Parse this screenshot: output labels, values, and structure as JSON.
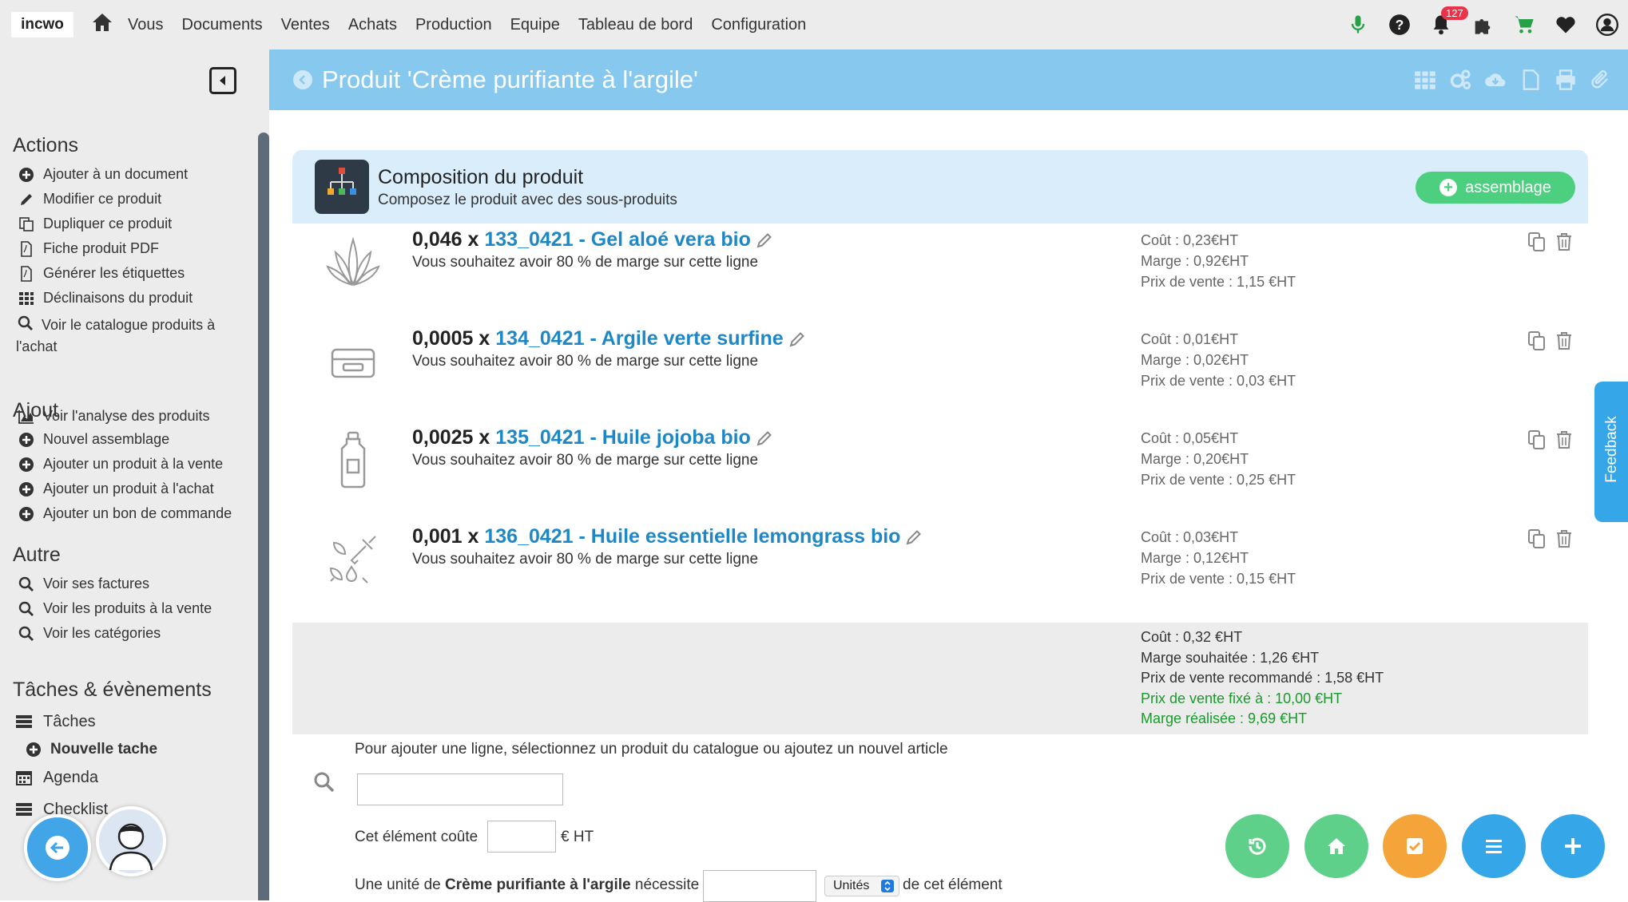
{
  "topbar": {
    "logo": "incwo",
    "menu": [
      "Vous",
      "Documents",
      "Ventes",
      "Achats",
      "Production",
      "Equipe",
      "Tableau de bord",
      "Configuration"
    ],
    "notification_count": "127"
  },
  "sidebar": {
    "actions_title": "Actions",
    "actions": [
      {
        "label": "Ajouter à un document",
        "icon": "plus-circle-icon"
      },
      {
        "label": "Modifier ce produit",
        "icon": "pencil-icon"
      },
      {
        "label": "Dupliquer ce produit",
        "icon": "copy-icon"
      },
      {
        "label": "Fiche produit PDF",
        "icon": "pdf-icon"
      },
      {
        "label": "Générer les étiquettes",
        "icon": "pdf-icon"
      },
      {
        "label": "Déclinaisons du produit",
        "icon": "grid-icon"
      },
      {
        "label": "Voir le catalogue produits à l'achat",
        "icon": "search-icon"
      },
      {
        "label": "Voir l'analyse des produits",
        "icon": "chart-icon"
      }
    ],
    "ajout_title": "Ajout",
    "ajout": [
      {
        "label": "Nouvel assemblage"
      },
      {
        "label": "Ajouter un produit à la vente"
      },
      {
        "label": "Ajouter un produit à l'achat"
      },
      {
        "label": "Ajouter un bon de commande"
      }
    ],
    "autre_title": "Autre",
    "autre": [
      {
        "label": "Voir ses factures"
      },
      {
        "label": "Voir les produits à la vente"
      },
      {
        "label": "Voir les catégories"
      }
    ],
    "taches_title": "Tâches & évènements",
    "taches": "Tâches",
    "nouvelle_tache": "Nouvelle tache",
    "agenda": "Agenda",
    "checklist": "Checklist"
  },
  "header": {
    "title": "Produit 'Crème purifiante à l'argile'"
  },
  "composition": {
    "title": "Composition du produit",
    "subtitle": "Composez le produit avec des sous-produits",
    "button": "assemblage",
    "rows": [
      {
        "qty": "0,046 x ",
        "name": "133_0421 - Gel aloé vera bio",
        "note": "Vous souhaitez avoir 80 % de marge sur cette ligne",
        "cout": "Coût : 0,23€HT",
        "marge": "Marge :  0,92€HT",
        "prix": "Prix de vente : 1,15 €HT",
        "thumb": "aloe-icon"
      },
      {
        "qty": "0,0005 x ",
        "name": "134_0421 - Argile verte surfine",
        "note": "Vous souhaitez avoir 80 % de marge sur cette ligne",
        "cout": "Coût : 0,01€HT",
        "marge": "Marge :  0,02€HT",
        "prix": "Prix de vente : 0,03 €HT",
        "thumb": "box-icon"
      },
      {
        "qty": "0,0025 x ",
        "name": "135_0421 - Huile jojoba bio",
        "note": "Vous souhaitez avoir 80 % de marge sur cette ligne",
        "cout": "Coût : 0,05€HT",
        "marge": "Marge :  0,20€HT",
        "prix": "Prix de vente : 0,25 €HT",
        "thumb": "bottle-icon"
      },
      {
        "qty": "0,001 x ",
        "name": "136_0421 - Huile essentielle lemongrass bio",
        "note": "Vous souhaitez avoir 80 % de marge sur cette ligne",
        "cout": "Coût : 0,03€HT",
        "marge": "Marge :  0,12€HT",
        "prix": "Prix de vente : 0,15 €HT",
        "thumb": "dropper-icon"
      }
    ],
    "totals": {
      "cout": "Coût : 0,32 €HT",
      "marge_souhaitee": "Marge souhaitée : 1,26 €HT",
      "prix_recommande": "Prix de vente recommandé : 1,58 €HT",
      "prix_fixe": "Prix de vente fixé à : 10,00 €HT",
      "marge_realisee": "Marge réalisée : 9,69 €HT"
    }
  },
  "form": {
    "add_line_text": "Pour ajouter une ligne, sélectionnez un produit du catalogue ou ajoutez un nouvel article",
    "cost_label": "Cet élément coûte",
    "cost_unit": "€ HT",
    "unit_prefix": "Une unité de ",
    "unit_product": "Crème purifiante à l'argile",
    "unit_suffix": " nécessite",
    "unit_select": "Unités",
    "unit_after": "de cet élément"
  },
  "feedback": "Feedback",
  "colors": {
    "header_blue": "#87c9ee",
    "link_blue": "#1e88c7",
    "green": "#4ccf7e",
    "orange": "#f5a43a",
    "fab_blue": "#35a7e8"
  }
}
